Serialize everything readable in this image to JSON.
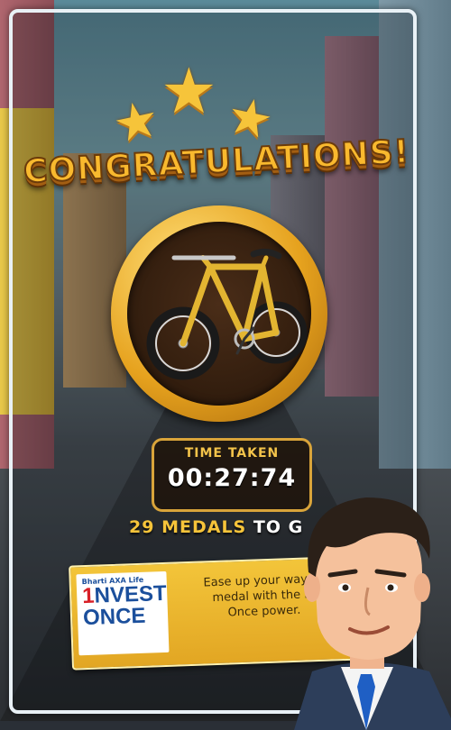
{
  "title": "CONGRATULATIONS!",
  "reward": {
    "icon": "bicycle-icon"
  },
  "time": {
    "label": "TIME TAKEN",
    "value": "00:27:74"
  },
  "medals": {
    "count": "29",
    "word": "MEDALS",
    "rest": "TO G"
  },
  "ad": {
    "logo_brand": "Bharti AXA Life",
    "logo_number": "1",
    "logo_line1": "NVEST",
    "logo_line2": "ONCE",
    "text_line1": "Ease up your way to",
    "text_line2": "medal with the In",
    "text_line3": "Once power."
  },
  "colors": {
    "gold": "#f6c43a",
    "panel_border": "#e9f1f6",
    "banner": "#f3c53a",
    "brand_blue": "#1b4f9c",
    "brand_red": "#d81f26"
  }
}
